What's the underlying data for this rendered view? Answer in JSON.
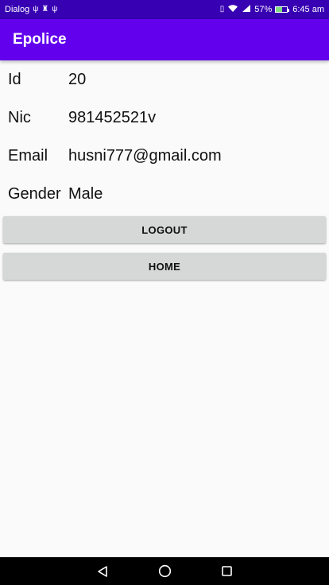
{
  "status_bar": {
    "carrier": "Dialog",
    "battery_percent": "57%",
    "battery_level": 0.57,
    "time": "6:45 am",
    "icons": [
      "usb-icon",
      "debug-icon",
      "usb-icon",
      "vibrate-icon",
      "wifi-icon",
      "signal-icon",
      "battery-icon"
    ]
  },
  "app_bar": {
    "title": "Epolice"
  },
  "profile": {
    "fields": [
      {
        "label": "Id",
        "value": "20"
      },
      {
        "label": "Nic",
        "value": "981452521v"
      },
      {
        "label": "Email",
        "value": "husni777@gmail.com"
      },
      {
        "label": "Gender",
        "value": "Male"
      }
    ]
  },
  "buttons": {
    "logout_label": "LOGOUT",
    "home_label": "HOME"
  },
  "nav_bar": {
    "icons": [
      "back-icon",
      "home-icon",
      "recents-icon"
    ]
  },
  "colors": {
    "status_bar": "#3700b3",
    "app_bar": "#6200ee",
    "button_bg": "#d6d7d7",
    "background": "#fafafa"
  }
}
